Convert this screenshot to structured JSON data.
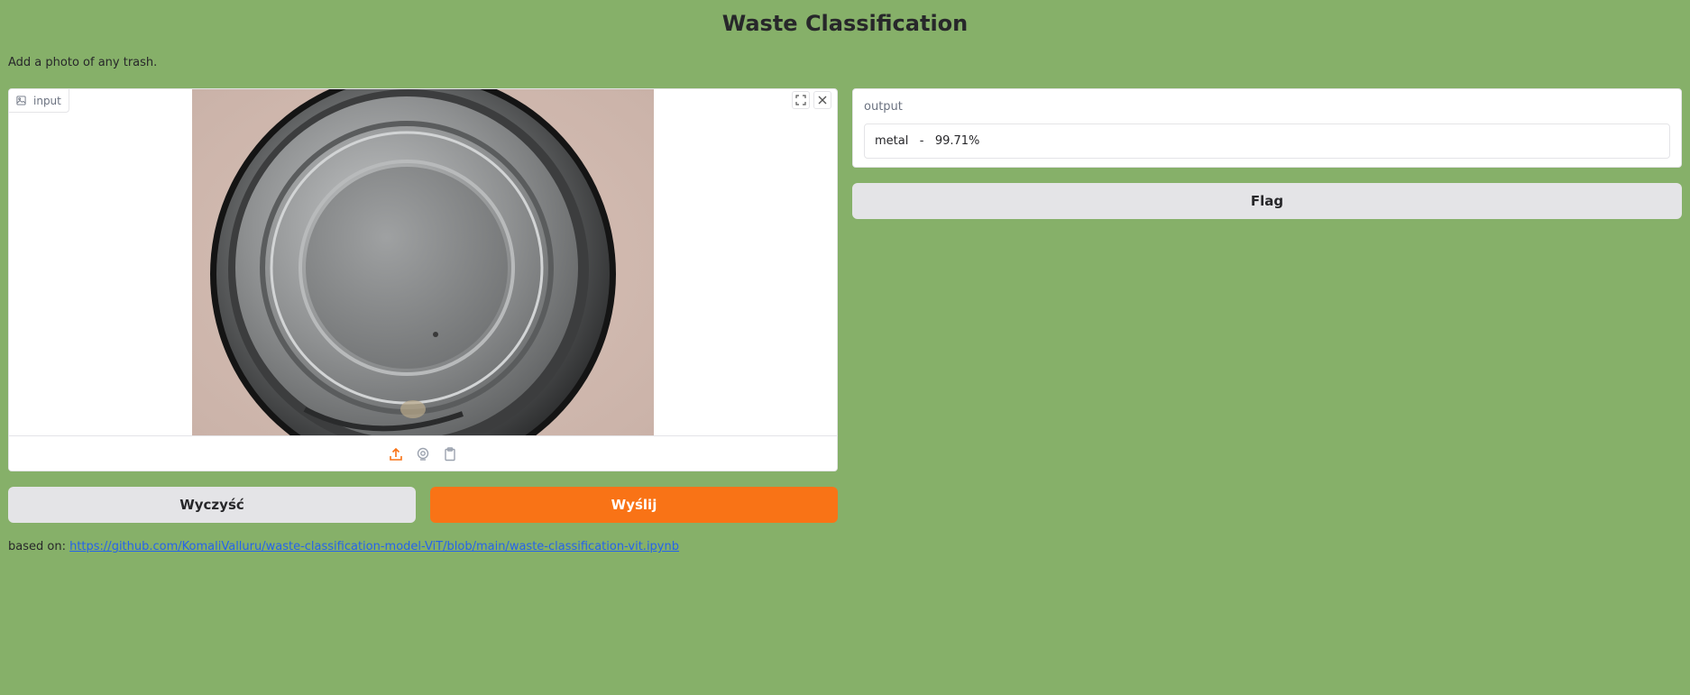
{
  "header": {
    "title": "Waste Classification",
    "description": "Add a photo of any trash."
  },
  "input": {
    "label": "input",
    "image_alt": "metal can"
  },
  "actions": {
    "clear_label": "Wyczyść",
    "submit_label": "Wyślij",
    "flag_label": "Flag"
  },
  "output": {
    "label": "output",
    "value": "metal   -   99.71%"
  },
  "footer": {
    "prefix": "based on: ",
    "link": "https://github.com/KomaliValluru/waste-classification-model-ViT/blob/main/waste-classification-vit.ipynb"
  },
  "colors": {
    "background": "#86b069",
    "primary": "#f97316",
    "secondary": "#e4e4e7",
    "link": "#2563eb"
  }
}
